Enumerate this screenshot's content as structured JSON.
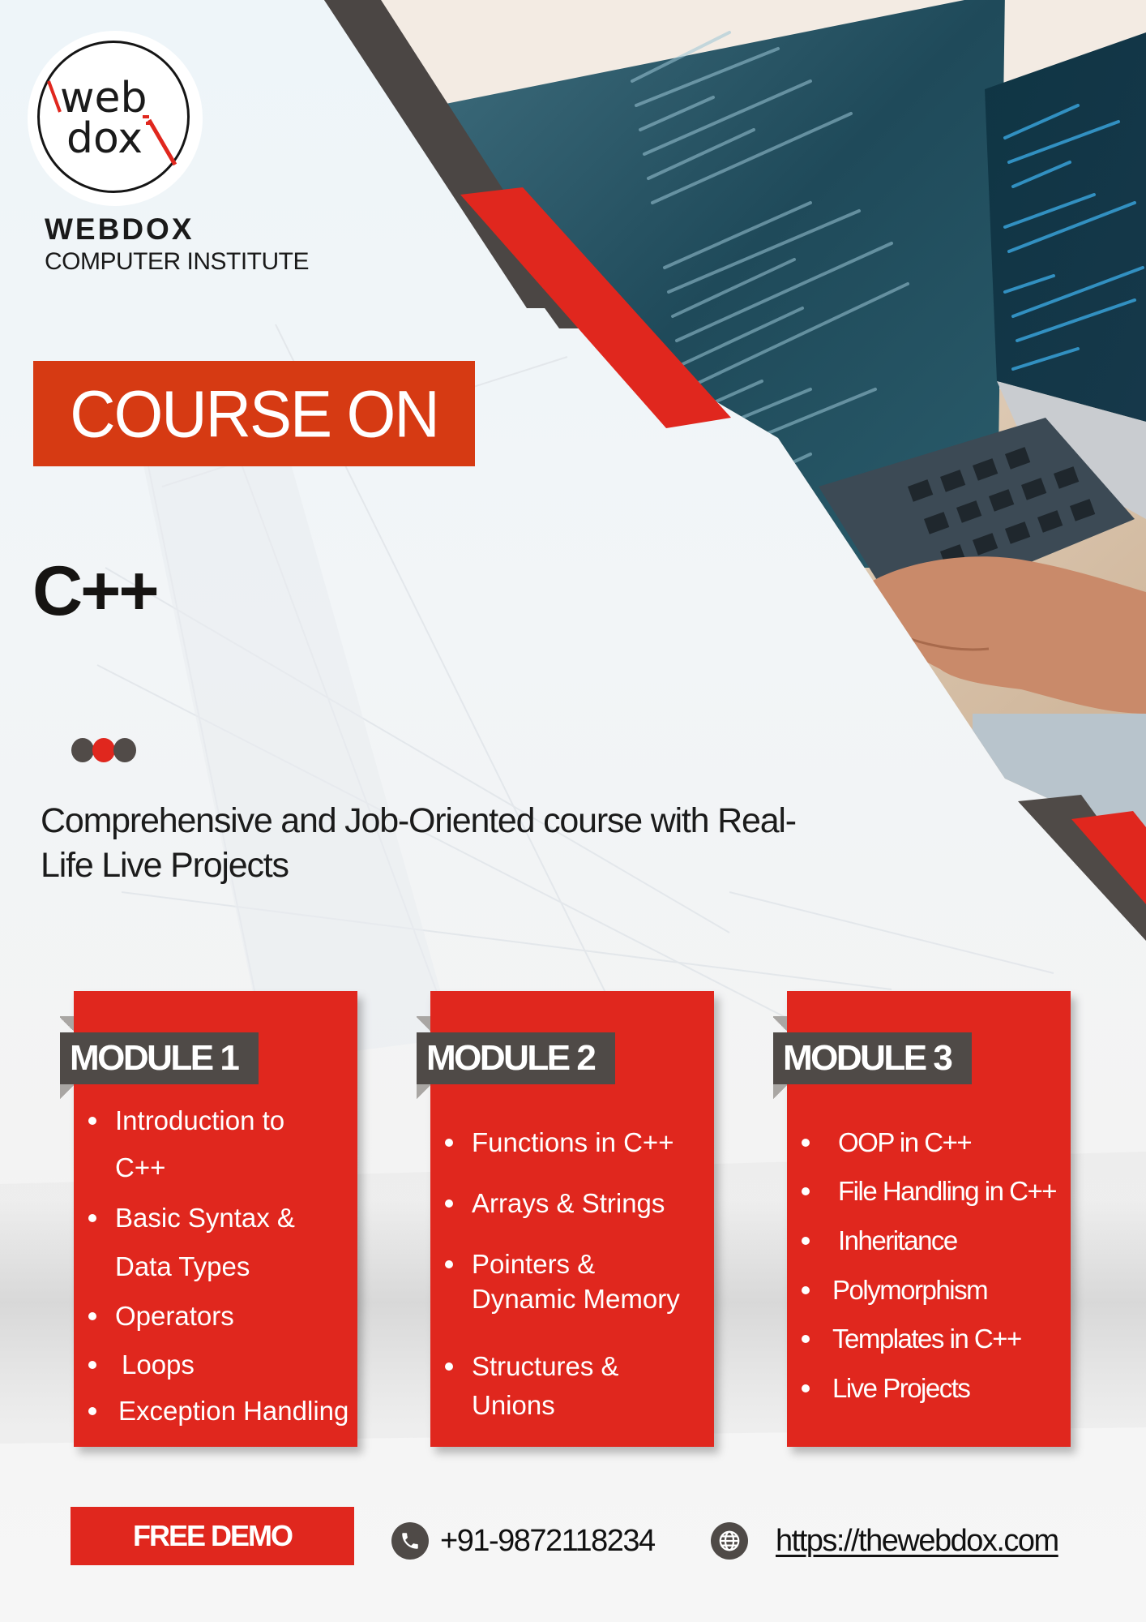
{
  "brand": {
    "logo_text_top": "web",
    "logo_text_bottom": "dox",
    "name": "WEBDOX",
    "subtitle": "COMPUTER INSTITUTE"
  },
  "hero": {
    "course_on_label": "COURSE ON",
    "course_name": "C++",
    "tagline": "Comprehensive and Job-Oriented course with Real-Life Live Projects",
    "tagline_line1": "Comprehensive and Job-Oriented course with Real-",
    "tagline_line2": "Life Live Projects",
    "dots": [
      "#514b48",
      "#e0271e",
      "#514b48"
    ]
  },
  "modules": [
    {
      "title": "MODULE 1",
      "items": [
        "Introduction to",
        "C++",
        "Basic Syntax &",
        "Data Types",
        "Operators",
        "Loops",
        "Exception Handling"
      ],
      "topics": [
        "Introduction to C++",
        "Basic Syntax & Data Types",
        "Operators",
        "Loops",
        "Exception Handling"
      ]
    },
    {
      "title": "MODULE 2",
      "items": [
        "Functions in C++",
        "Arrays & Strings",
        "Pointers &",
        "Dynamic Memory",
        "Structures &",
        "Unions"
      ],
      "topics": [
        "Functions in C++",
        "Arrays & Strings",
        "Pointers & Dynamic Memory",
        "Structures & Unions"
      ]
    },
    {
      "title": "MODULE 3",
      "items": [
        "OOP in C++",
        "File Handling in C++",
        "Inheritance",
        "Polymorphism",
        "Templates in C++",
        "Live Projects"
      ],
      "topics": [
        "OOP in C++",
        "File Handling in C++",
        "Inheritance",
        "Polymorphism",
        "Templates in C++",
        "Live Projects"
      ]
    }
  ],
  "footer": {
    "cta_label": "FREE DEMO",
    "phone": "+91-9872118234",
    "phone_icon": "phone-icon",
    "website": "https://thewebdox.com",
    "website_icon": "globe-icon"
  },
  "colors": {
    "accent_red": "#e0271e",
    "course_on_red": "#d63a13",
    "dark_gray": "#4f4a47",
    "text_dark": "#1b1b1b"
  }
}
